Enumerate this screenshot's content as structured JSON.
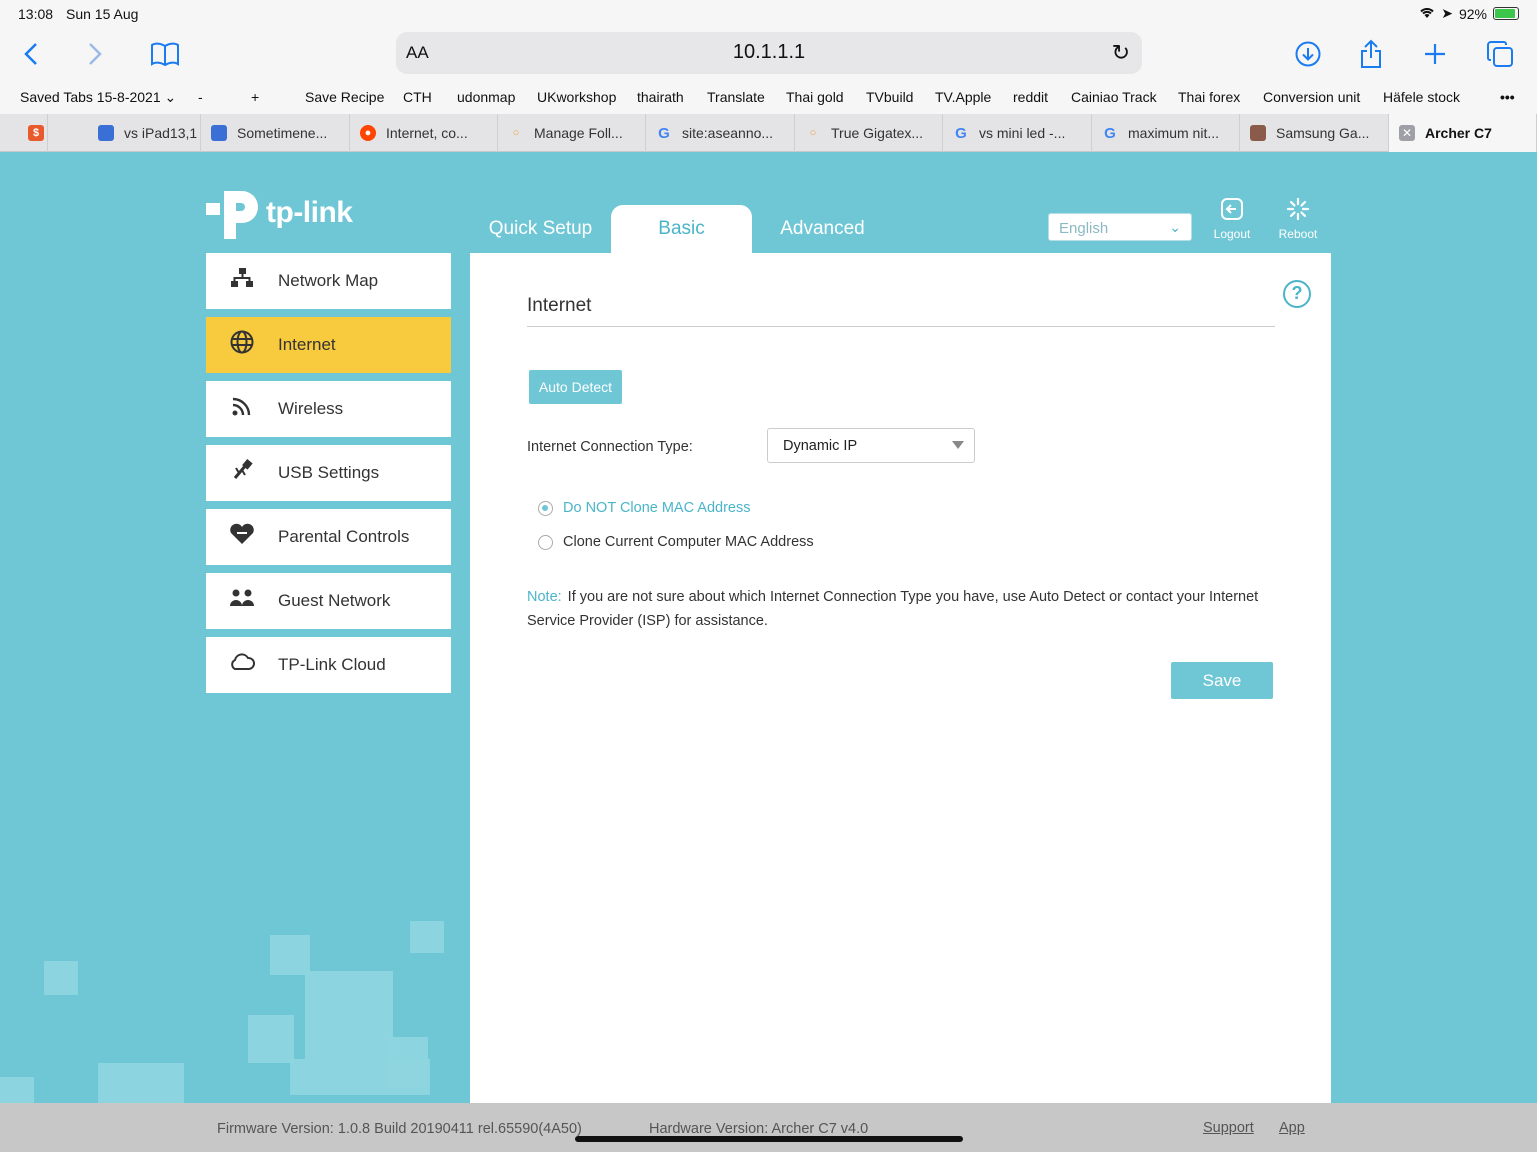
{
  "status_bar": {
    "time": "13:08",
    "date": "Sun 15 Aug",
    "battery": "92%"
  },
  "browser": {
    "aa_label": "AA",
    "url": "10.1.1.1",
    "bookmarks": [
      "Saved Tabs 15-8-2021",
      "-",
      "+",
      "Save Recipe",
      "CTH",
      "udonmap",
      "UKworkshop",
      "thairath",
      "Translate",
      "Thai gold",
      "TVbuild",
      "TV.Apple",
      "reddit",
      "Cainiao Track",
      "Thai forex",
      "Conversion unit",
      "Häfele stock",
      "•••"
    ],
    "tabs": [
      "vs iPad13,1",
      "Sometimene...",
      "Internet, co...",
      "Manage Foll...",
      "site:aseanno...",
      "True Gigatex...",
      "vs mini led -...",
      "maximum nit...",
      "Samsung Ga...",
      "Archer C7"
    ]
  },
  "router": {
    "brand": "tp-link",
    "nav_tabs": [
      "Quick Setup",
      "Basic",
      "Advanced"
    ],
    "language": "English",
    "logout_label": "Logout",
    "reboot_label": "Reboot",
    "sidebar": [
      "Network Map",
      "Internet",
      "Wireless",
      "USB Settings",
      "Parental Controls",
      "Guest Network",
      "TP-Link Cloud"
    ],
    "panel": {
      "title": "Internet",
      "auto_detect": "Auto Detect",
      "connection_label": "Internet Connection Type:",
      "connection_value": "Dynamic IP",
      "radio_1": "Do NOT Clone MAC Address",
      "radio_2": "Clone Current Computer MAC Address",
      "note_key": "Note:",
      "note_text": "If you are not sure about which Internet Connection Type you have, use Auto Detect or contact your Internet Service Provider (ISP) for assistance.",
      "save": "Save"
    },
    "footer": {
      "firmware": "Firmware Version: 1.0.8 Build 20190411 rel.65590(4A50)",
      "hardware": "Hardware Version: Archer C7 v4.0",
      "support": "Support",
      "app": "App"
    }
  },
  "colors": {
    "accent": "#6fc7d6",
    "active_menu": "#f8ca3e",
    "ios_blue": "#1a7cf0"
  }
}
